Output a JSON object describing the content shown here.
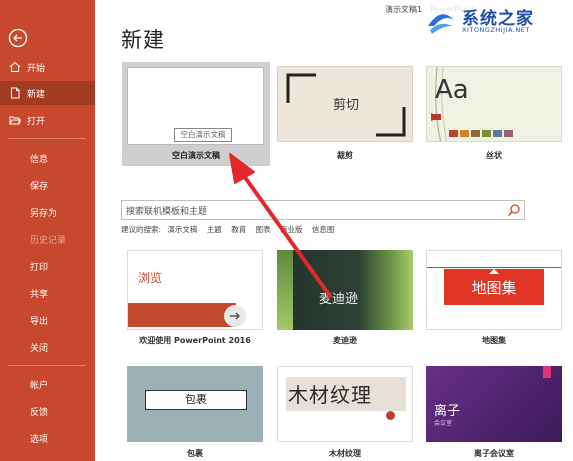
{
  "window": {
    "title": "演示文稿1 - PowerPoint"
  },
  "sidebar": {
    "items": [
      {
        "label": "开始"
      },
      {
        "label": "新建"
      },
      {
        "label": "打开"
      },
      {
        "label": "信息"
      },
      {
        "label": "保存"
      },
      {
        "label": "另存为"
      },
      {
        "label": "历史记录"
      },
      {
        "label": "打印"
      },
      {
        "label": "共享"
      },
      {
        "label": "导出"
      },
      {
        "label": "关闭"
      },
      {
        "label": "帐户"
      },
      {
        "label": "反馈"
      },
      {
        "label": "选项"
      }
    ],
    "colors": {
      "bg": "#c8482e",
      "active": "#a33a22"
    }
  },
  "main": {
    "title": "新建",
    "featured": [
      {
        "caption": "空白演示文稿",
        "thumb_text": "空白演示文稿"
      },
      {
        "caption": "裁剪",
        "thumb_text": "剪切"
      },
      {
        "caption": "丝状",
        "thumb_text": "Aa"
      }
    ],
    "search": {
      "placeholder": "搜索联机模板和主题",
      "suggest_label": "建议的搜索:",
      "suggestions": [
        "演示文稿",
        "主题",
        "教育",
        "图表",
        "商业版",
        "信息图"
      ]
    },
    "templates": [
      {
        "caption": "欢迎使用 PowerPoint 2016",
        "thumb_text": "浏览"
      },
      {
        "caption": "麦迪逊",
        "thumb_text": "麦迪逊"
      },
      {
        "caption": "地图集",
        "thumb_text": "地图集"
      },
      {
        "caption": "包裹",
        "thumb_text": "包裹"
      },
      {
        "caption": "木材纹理",
        "thumb_text": "木材纹理"
      },
      {
        "caption": "离子会议室",
        "thumb_text": "离子",
        "thumb_sub": "会议室"
      }
    ]
  },
  "watermark": {
    "text": "系统之家",
    "url_text": "XITONGZHIJIA.NET"
  },
  "annotation": {
    "arrow_color": "#e3282b"
  }
}
